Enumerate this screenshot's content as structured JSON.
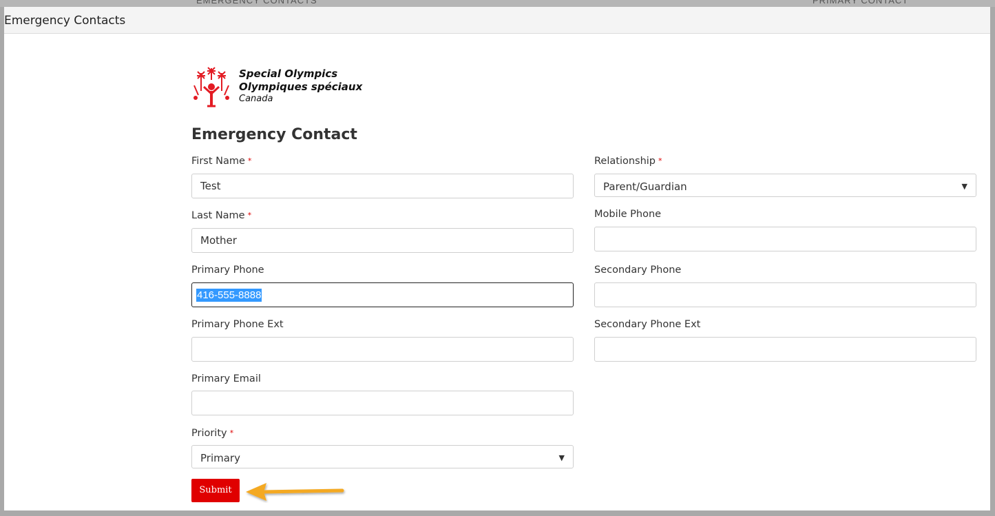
{
  "background": {
    "text_left": "EMERGENCY CONTACTS",
    "text_right": "PRIMARY CONTACT"
  },
  "window": {
    "title": "Emergency Contacts"
  },
  "logo": {
    "line1": "Special Olympics",
    "line2": "Olympiques spéciaux",
    "line3": "Canada"
  },
  "form": {
    "title": "Emergency Contact",
    "required_marker": "*",
    "first_name": {
      "label": "First Name",
      "value": "Test"
    },
    "last_name": {
      "label": "Last Name",
      "value": "Mother"
    },
    "primary_phone": {
      "label": "Primary Phone",
      "value": "416-555-8888"
    },
    "primary_phone_ext": {
      "label": "Primary Phone Ext",
      "value": ""
    },
    "primary_email": {
      "label": "Primary Email",
      "value": ""
    },
    "priority": {
      "label": "Priority",
      "value": "Primary"
    },
    "relationship": {
      "label": "Relationship",
      "value": "Parent/Guardian"
    },
    "mobile_phone": {
      "label": "Mobile Phone",
      "value": ""
    },
    "secondary_phone": {
      "label": "Secondary Phone",
      "value": ""
    },
    "secondary_phone_ext": {
      "label": "Secondary Phone Ext",
      "value": ""
    },
    "submit_label": "Submit"
  },
  "icons": {
    "dropdown": "triangle-down-icon",
    "annotation": "arrow-left-icon"
  },
  "colors": {
    "brand_red": "#e00000",
    "annotation_arrow": "#f4a923",
    "selection": "#3399ff"
  }
}
